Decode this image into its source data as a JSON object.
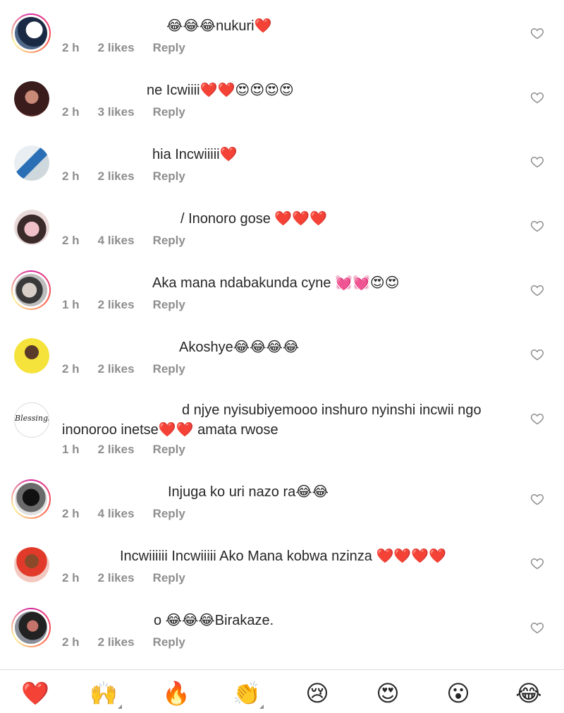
{
  "comments": [
    {
      "text": "😂😂😂nukuri❤️",
      "time": "2 h",
      "likes": "2 likes",
      "reply": "Reply"
    },
    {
      "text": "ne Icwiiii❤️❤️😍😍😍😍",
      "time": "2 h",
      "likes": "3 likes",
      "reply": "Reply"
    },
    {
      "text": "hia Incwiiiii❤️",
      "time": "2 h",
      "likes": "2 likes",
      "reply": "Reply"
    },
    {
      "text": "/ Inonoro gose ❤️❤️❤️",
      "time": "2 h",
      "likes": "4 likes",
      "reply": "Reply"
    },
    {
      "text": "Aka mana ndabakunda cyne 💓💓😍😍",
      "time": "1 h",
      "likes": "2 likes",
      "reply": "Reply"
    },
    {
      "text": "Akoshye😂😂😂😂",
      "time": "2 h",
      "likes": "2 likes",
      "reply": "Reply"
    },
    {
      "text": "d njye nyisubiyemooo inshuro nyinshi incwii ngo",
      "text2": "inonoroo inetse❤️❤️ amata rwose",
      "time": "1 h",
      "likes": "2 likes",
      "reply": "Reply"
    },
    {
      "text": "Injuga ko uri nazo ra😂😂",
      "time": "2 h",
      "likes": "4 likes",
      "reply": "Reply"
    },
    {
      "text": "Incwiiiiii Incwiiiii Ako Mana kobwa nzinza ❤️❤️❤️❤️",
      "time": "2 h",
      "likes": "2 likes",
      "reply": "Reply"
    },
    {
      "text": "o 😂😂😂Birakaze.",
      "time": "2 h",
      "likes": "2 likes",
      "reply": "Reply"
    }
  ],
  "reactions": [
    "❤️",
    "🙌",
    "🔥",
    "👏",
    "😢",
    "😍",
    "😮",
    "😂"
  ],
  "colors": {
    "text": "#262626",
    "meta": "#8e8e8e",
    "divider": "#dbdbdb"
  }
}
